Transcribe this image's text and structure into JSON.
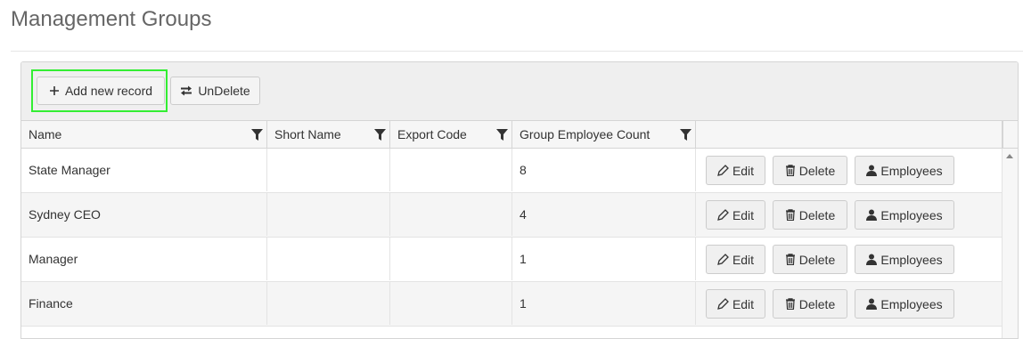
{
  "page": {
    "title": "Management Groups"
  },
  "toolbar": {
    "add_label": "Add new record",
    "undelete_label": "UnDelete"
  },
  "columns": [
    {
      "label": "Name",
      "filter_icon": "filter-icon"
    },
    {
      "label": "Short Name",
      "filter_icon": "filter-icon"
    },
    {
      "label": "Export Code",
      "filter_icon": "filter-icon"
    },
    {
      "label": "Group Employee Count",
      "filter_icon": "filter-icon"
    }
  ],
  "row_actions": {
    "edit": "Edit",
    "delete": "Delete",
    "employees": "Employees"
  },
  "rows": [
    {
      "name": "State Manager",
      "short_name": "",
      "export_code": "",
      "count": "8"
    },
    {
      "name": "Sydney CEO",
      "short_name": "",
      "export_code": "",
      "count": "4"
    },
    {
      "name": "Manager",
      "short_name": "",
      "export_code": "",
      "count": "1"
    },
    {
      "name": "Finance",
      "short_name": "",
      "export_code": "",
      "count": "1"
    }
  ],
  "colors": {
    "highlight": "#33ee33",
    "title": "#666666",
    "border": "#d5d5d5"
  }
}
